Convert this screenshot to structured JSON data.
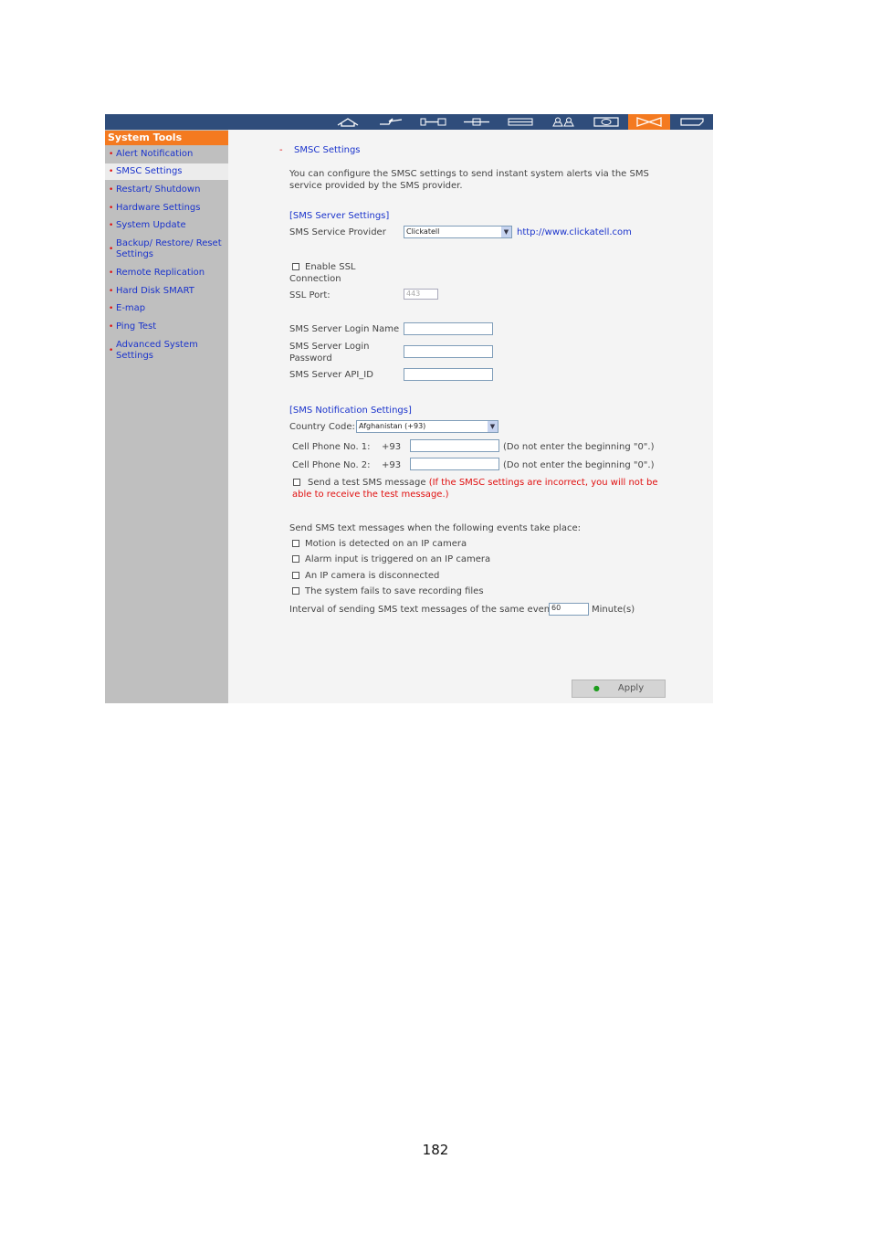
{
  "toolbar": {
    "icons": [
      "home-icon",
      "network-icon",
      "device-config-icon",
      "network-service-icon",
      "storage-icon",
      "users-icon",
      "camera-icon",
      "system-tools-icon",
      "logout-icon"
    ],
    "active_index": 7,
    "bar_color": "#2f4d7b",
    "active_color": "#f47a20"
  },
  "sidebar": {
    "title": "System Tools",
    "items": [
      {
        "label": "Alert Notification"
      },
      {
        "label": "SMSC Settings"
      },
      {
        "label": "Restart/ Shutdown"
      },
      {
        "label": "Hardware Settings"
      },
      {
        "label": "System Update"
      },
      {
        "label": "Backup/ Restore/ Reset Settings"
      },
      {
        "label": "Remote Replication"
      },
      {
        "label": "Hard Disk SMART"
      },
      {
        "label": "E-map"
      },
      {
        "label": "Ping Test"
      },
      {
        "label": "Advanced System Settings"
      }
    ]
  },
  "main": {
    "dash": "-",
    "title": "SMSC Settings",
    "description": "You can configure the SMSC settings to send instant system alerts via the SMS service provided by the SMS provider.",
    "server_section": "[SMS Server Settings]",
    "provider_label": "SMS Service Provider",
    "provider_value": "Clickatell",
    "provider_link": "http://www.clickatell.com",
    "ssl_label": "Enable SSL Connection",
    "ssl_port_label": "SSL Port:",
    "ssl_port_value": "443",
    "login_name_label": "SMS Server Login Name",
    "login_password_label": "SMS Server Login Password",
    "api_id_label": "SMS Server API_ID",
    "notification_section": "[SMS Notification Settings]",
    "country_label": "Country Code:",
    "country_value": "Afghanistan (+93)",
    "phone1_label": "Cell Phone No. 1:",
    "phone2_label": "Cell Phone No. 2:",
    "phone_prefix": "+93",
    "phone_hint": "(Do not enter the beginning \"0\".)",
    "test_label": "Send a test SMS message",
    "test_warning": "(If the SMSC settings are incorrect, you will not be able to receive the test message.)",
    "events_intro": "Send SMS text messages when the following events take place:",
    "events": [
      {
        "label": "Motion is detected on an IP camera"
      },
      {
        "label": "Alarm input is triggered on an IP camera"
      },
      {
        "label": "An IP camera is disconnected"
      },
      {
        "label": "The system fails to save recording files"
      }
    ],
    "interval_label": "Interval of sending SMS text messages of the same events:",
    "interval_value": "60",
    "interval_unit": "Minute(s)",
    "apply_label": "Apply"
  },
  "page_number": "182"
}
